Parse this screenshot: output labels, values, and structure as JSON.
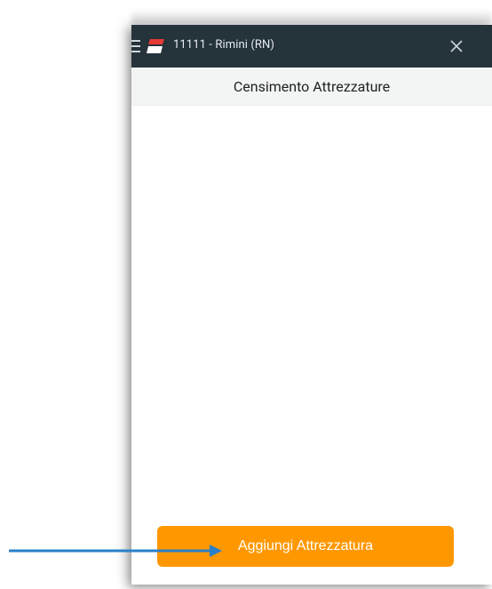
{
  "header": {
    "title": "11111 - Rimini (RN)",
    "brand_color": "#25333b",
    "logo_color": "#e53935"
  },
  "subheader": {
    "title": "Censimento Attrezzature"
  },
  "footer": {
    "add_button_label": "Aggiungi Attrezzatura",
    "add_button_color": "#ff9800"
  },
  "annotation": {
    "arrow_color": "#2a7fc9"
  },
  "icons": {
    "menu": "hamburger-menu-icon",
    "logo": "flag-logo-icon",
    "close": "close-icon",
    "arrow": "arrow-right-icon"
  }
}
